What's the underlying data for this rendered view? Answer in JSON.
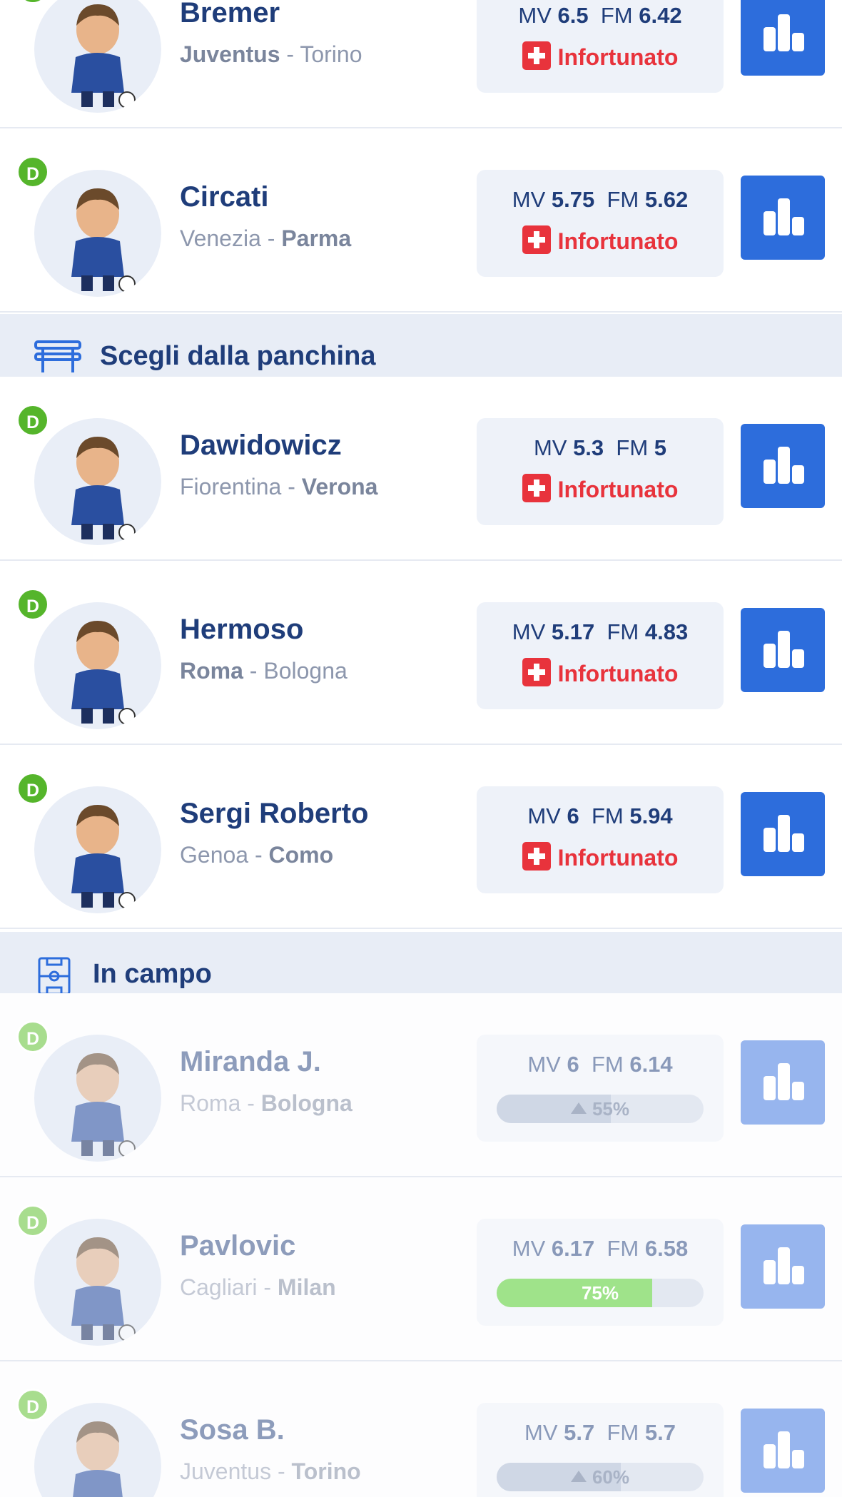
{
  "colors": {
    "primary": "#2d6ddc",
    "injury_red": "#e8333c",
    "role_green": "#55b52b",
    "navy_text": "#1f3d7a",
    "section_bg": "#e8edf6",
    "progress_green": "#9fe38a"
  },
  "labels": {
    "mv": "MV",
    "fm": "FM",
    "separator": " - ",
    "injured": "Infortunato"
  },
  "sections": {
    "bench": {
      "title": "Scegli dalla panchina",
      "icon": "bench-icon"
    },
    "field": {
      "title": "In campo",
      "icon": "pitch-icon"
    }
  },
  "players": [
    {
      "role": "D",
      "name": "Bremer",
      "home_team": "Juventus",
      "away_team": "Torino",
      "highlight": "home",
      "mv": "6.5",
      "fm": "6.42",
      "status": "injured"
    },
    {
      "role": "D",
      "name": "Circati",
      "home_team": "Venezia",
      "away_team": "Parma",
      "highlight": "away",
      "mv": "5.75",
      "fm": "5.62",
      "status": "injured"
    },
    {
      "role": "D",
      "name": "Dawidowicz",
      "home_team": "Fiorentina",
      "away_team": "Verona",
      "highlight": "away",
      "mv": "5.3",
      "fm": "5",
      "status": "injured"
    },
    {
      "role": "D",
      "name": "Hermoso",
      "home_team": "Roma",
      "away_team": "Bologna",
      "highlight": "home",
      "mv": "5.17",
      "fm": "4.83",
      "status": "injured"
    },
    {
      "role": "D",
      "name": "Sergi Roberto",
      "home_team": "Genoa",
      "away_team": "Como",
      "highlight": "away",
      "mv": "6",
      "fm": "5.94",
      "status": "injured"
    },
    {
      "role": "D",
      "name": "Miranda J.",
      "home_team": "Roma",
      "away_team": "Bologna",
      "highlight": "away",
      "mv": "6",
      "fm": "6.14",
      "status": "probability",
      "probability": "55%",
      "probability_value": 0.55,
      "trend": "up"
    },
    {
      "role": "D",
      "name": "Pavlovic",
      "home_team": "Cagliari",
      "away_team": "Milan",
      "highlight": "away",
      "mv": "6.17",
      "fm": "6.58",
      "status": "probability",
      "probability": "75%",
      "probability_value": 0.75,
      "trend": "none"
    },
    {
      "role": "D",
      "name": "Sosa B.",
      "home_team": "Juventus",
      "away_team": "Torino",
      "highlight": "away",
      "mv": "5.7",
      "fm": "5.7",
      "status": "probability",
      "probability": "60%",
      "probability_value": 0.6,
      "trend": "up"
    }
  ],
  "icons": {
    "stats_button": "bar-chart-icon",
    "injury": "medical-cross-icon",
    "trend": "triangle-up-icon",
    "avatar": "player-avatar-illustration"
  }
}
